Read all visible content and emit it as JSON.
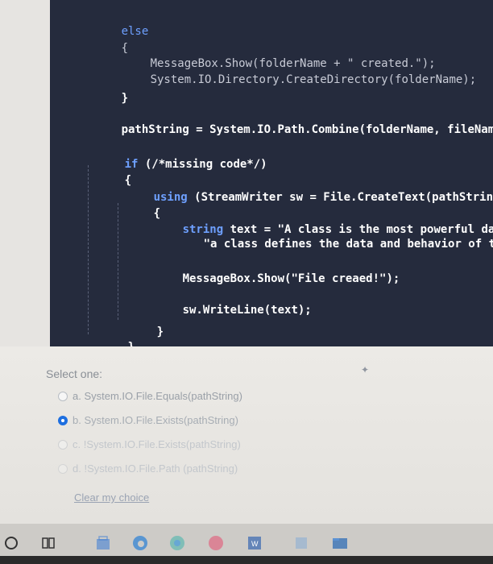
{
  "code": {
    "else_kw": "else",
    "open_brace_1": "{",
    "msgbox_call_1": "MessageBox.Show(folderName + \" created.\");",
    "create_dir": "System.IO.Directory.CreateDirectory(folderName);",
    "close_brace_1": "}",
    "path_line": "pathString = System.IO.Path.Combine(folderName, fileName);",
    "if_kw": "if",
    "if_rest": " (/*missing code*/)",
    "open_brace_2": "{",
    "using_kw": "using",
    "using_rest": " (StreamWriter sw = File.CreateText(pathString))",
    "open_brace_3": "{",
    "string_kw": "string",
    "text_assign": " text = \"A class is the most powerful data ty",
    "text_cont": "\"a class defines the data and behavior of the da",
    "msgbox_call_2": "MessageBox.Show(\"File creaed!\");",
    "writeline": "sw.WriteLine(text);",
    "close_brace_3": "}",
    "close_brace_2": "}"
  },
  "quiz": {
    "prompt": "Select one:",
    "options": [
      {
        "label": "a. System.IO.File.Equals(pathString)",
        "selected": false
      },
      {
        "label": "b. System.IO.File.Exists(pathString)",
        "selected": true
      },
      {
        "label": "c. !System.IO.File.Exists(pathString)",
        "selected": false
      },
      {
        "label": "d. !System.IO.File.Path (pathString)",
        "selected": false
      }
    ],
    "clear_label": "Clear my choice"
  },
  "taskbar": {
    "icons": [
      "start-circle-icon",
      "task-view-icon",
      "store-icon",
      "edge-icon",
      "chrome-icon",
      "app-icon",
      "word-icon",
      "app-icon-2",
      "file-explorer-icon"
    ]
  },
  "colors": {
    "editor_bg": "#252b3d",
    "keyword": "#6ea0ff",
    "radio_selected": "#1e6fe0"
  }
}
